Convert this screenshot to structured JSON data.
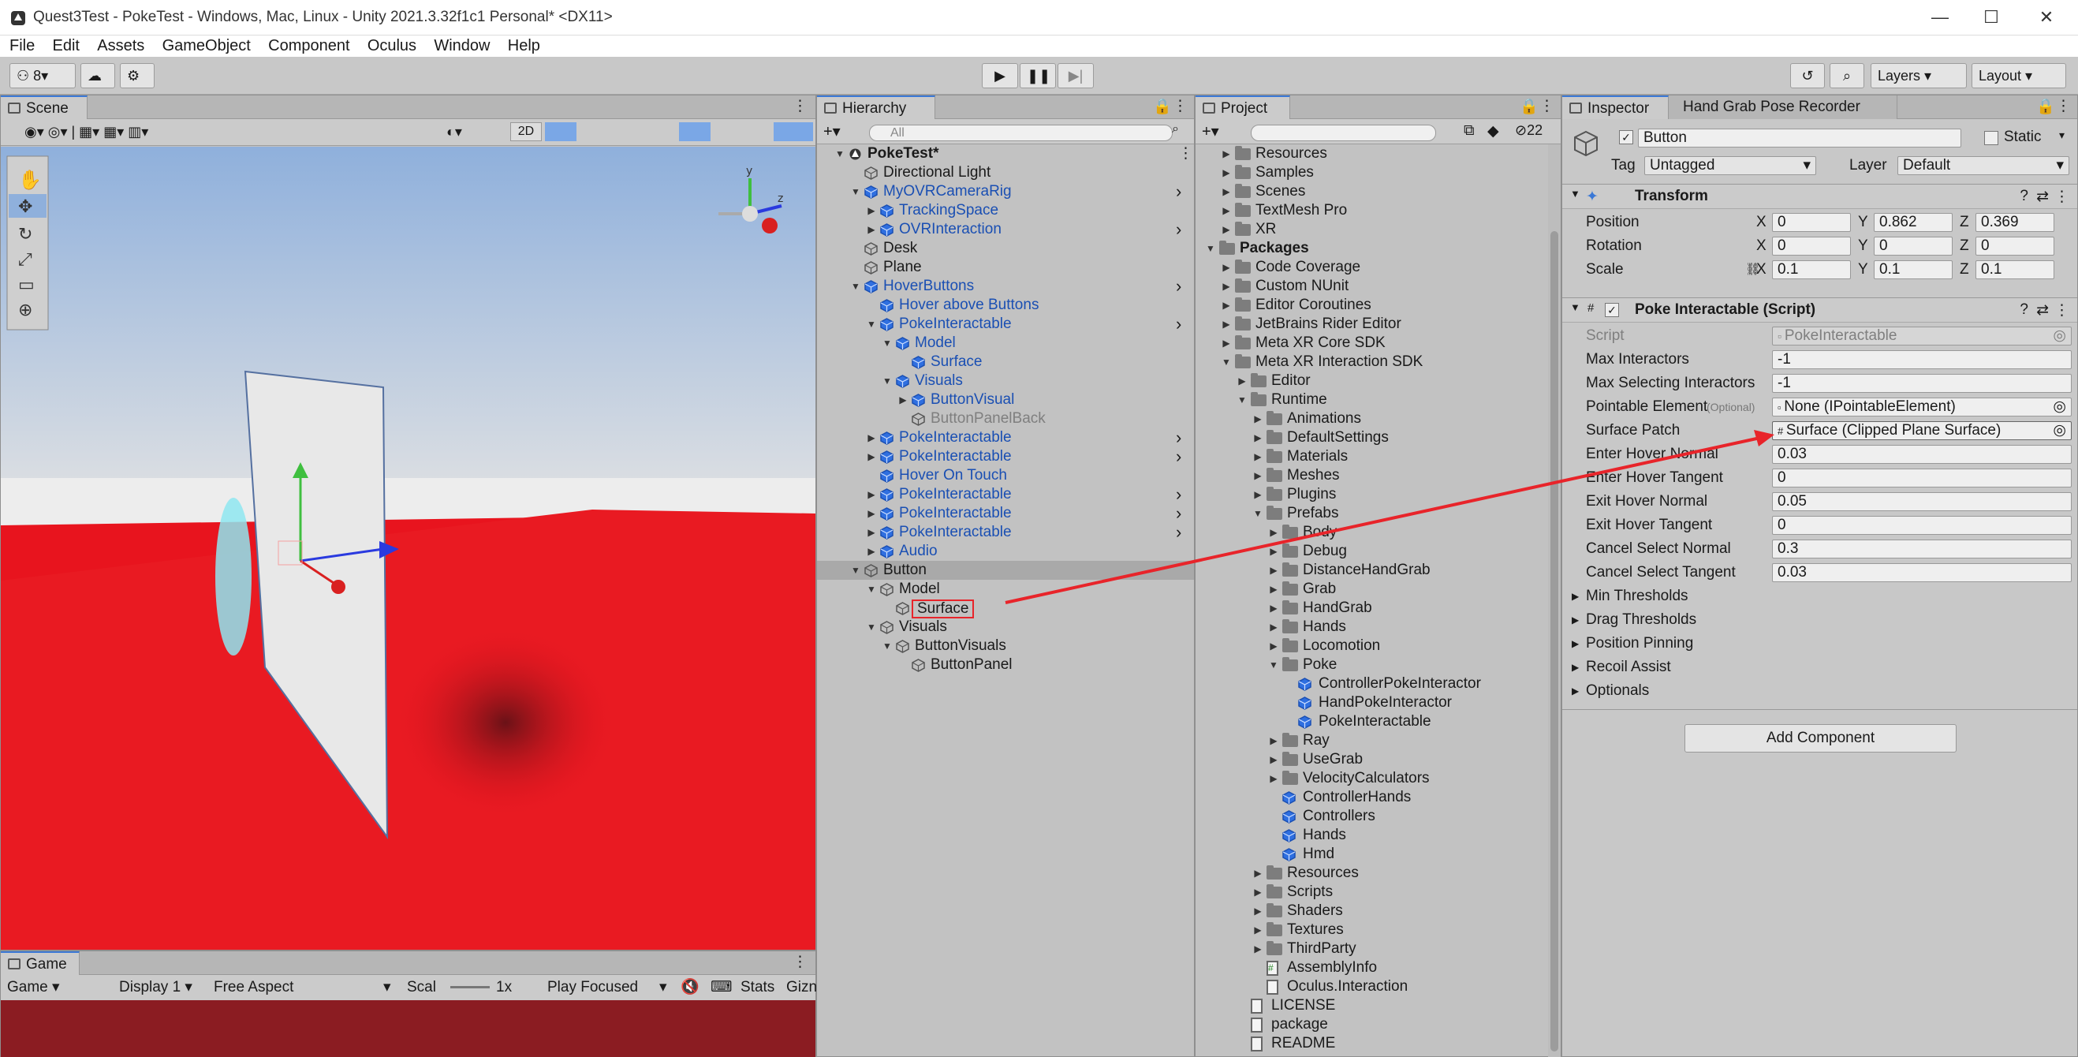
{
  "window": {
    "title": "Quest3Test - PokeTest - Windows, Mac, Linux - Unity 2021.3.32f1c1 Personal* <DX11>",
    "minimize": "—",
    "maximize": "☐",
    "close": "✕"
  },
  "menu": [
    "File",
    "Edit",
    "Assets",
    "GameObject",
    "Component",
    "Oculus",
    "Window",
    "Help"
  ],
  "toolbar": {
    "account_label": "⚇ 8▾",
    "layers_label": "Layers",
    "layout_label": "Layout"
  },
  "scene": {
    "tab": "Scene",
    "mode_2d": "2D"
  },
  "game": {
    "tab": "Game",
    "dropdowns": [
      "Game",
      "Display 1",
      "Free Aspect"
    ],
    "scale_label": "Scal",
    "scale_value": "1x",
    "play_focused": "Play Focused",
    "stats": "Stats",
    "gizmos": "Gizn"
  },
  "hierarchy": {
    "tab": "Hierarchy",
    "search_placeholder": "All",
    "items": [
      {
        "label": "PokeTest*",
        "bold": true,
        "indent": 0,
        "tri": "▼"
      },
      {
        "label": "Directional Light",
        "indent": 1,
        "tri": ""
      },
      {
        "label": "MyOVRCameraRig",
        "indent": 1,
        "tri": "▼",
        "blue": true,
        "arrow": true
      },
      {
        "label": "TrackingSpace",
        "indent": 2,
        "tri": "▶",
        "blue": true
      },
      {
        "label": "OVRInteraction",
        "indent": 2,
        "tri": "▶",
        "blue": true,
        "arrow": true
      },
      {
        "label": "Desk",
        "indent": 1,
        "tri": ""
      },
      {
        "label": "Plane",
        "indent": 1,
        "tri": ""
      },
      {
        "label": "HoverButtons",
        "indent": 1,
        "tri": "▼",
        "blue": true,
        "arrow": true
      },
      {
        "label": "Hover above Buttons",
        "indent": 2,
        "tri": "",
        "blue": true
      },
      {
        "label": "PokeInteractable",
        "indent": 2,
        "tri": "▼",
        "blue": true,
        "arrow": true
      },
      {
        "label": "Model",
        "indent": 3,
        "tri": "▼",
        "blue": true
      },
      {
        "label": "Surface",
        "indent": 4,
        "tri": "",
        "blue": true
      },
      {
        "label": "Visuals",
        "indent": 3,
        "tri": "▼",
        "blue": true
      },
      {
        "label": "ButtonVisual",
        "indent": 4,
        "tri": "▶",
        "blue": true
      },
      {
        "label": "ButtonPanelBack",
        "indent": 4,
        "tri": "",
        "grey": true
      },
      {
        "label": "PokeInteractable",
        "indent": 2,
        "tri": "▶",
        "blue": true,
        "arrow": true
      },
      {
        "label": "PokeInteractable",
        "indent": 2,
        "tri": "▶",
        "blue": true,
        "arrow": true
      },
      {
        "label": "Hover On Touch",
        "indent": 2,
        "tri": "",
        "blue": true
      },
      {
        "label": "PokeInteractable",
        "indent": 2,
        "tri": "▶",
        "blue": true,
        "arrow": true
      },
      {
        "label": "PokeInteractable",
        "indent": 2,
        "tri": "▶",
        "blue": true,
        "arrow": true
      },
      {
        "label": "PokeInteractable",
        "indent": 2,
        "tri": "▶",
        "blue": true,
        "arrow": true
      },
      {
        "label": "Audio",
        "indent": 2,
        "tri": "▶",
        "blue": true
      },
      {
        "label": "Button",
        "indent": 1,
        "tri": "▼",
        "selected": true
      },
      {
        "label": "Model",
        "indent": 2,
        "tri": "▼"
      },
      {
        "label": "Surface",
        "indent": 3,
        "tri": "",
        "boxed": true
      },
      {
        "label": "Visuals",
        "indent": 2,
        "tri": "▼"
      },
      {
        "label": "ButtonVisuals",
        "indent": 3,
        "tri": "▼"
      },
      {
        "label": "ButtonPanel",
        "indent": 4,
        "tri": ""
      }
    ]
  },
  "project": {
    "tab": "Project",
    "badge": "22",
    "items": [
      {
        "label": "Resources",
        "indent": 1,
        "tri": "▶",
        "kind": "folder"
      },
      {
        "label": "Samples",
        "indent": 1,
        "tri": "▶",
        "kind": "folder"
      },
      {
        "label": "Scenes",
        "indent": 1,
        "tri": "▶",
        "kind": "folder"
      },
      {
        "label": "TextMesh Pro",
        "indent": 1,
        "tri": "▶",
        "kind": "folder"
      },
      {
        "label": "XR",
        "indent": 1,
        "tri": "▶",
        "kind": "folder"
      },
      {
        "label": "Packages",
        "indent": 0,
        "tri": "▼",
        "kind": "folder",
        "bold": true
      },
      {
        "label": "Code Coverage",
        "indent": 1,
        "tri": "▶",
        "kind": "folder"
      },
      {
        "label": "Custom NUnit",
        "indent": 1,
        "tri": "▶",
        "kind": "folder"
      },
      {
        "label": "Editor Coroutines",
        "indent": 1,
        "tri": "▶",
        "kind": "folder"
      },
      {
        "label": "JetBrains Rider Editor",
        "indent": 1,
        "tri": "▶",
        "kind": "folder"
      },
      {
        "label": "Meta XR Core SDK",
        "indent": 1,
        "tri": "▶",
        "kind": "folder"
      },
      {
        "label": "Meta XR Interaction SDK",
        "indent": 1,
        "tri": "▼",
        "kind": "folder"
      },
      {
        "label": "Editor",
        "indent": 2,
        "tri": "▶",
        "kind": "folder"
      },
      {
        "label": "Runtime",
        "indent": 2,
        "tri": "▼",
        "kind": "folder"
      },
      {
        "label": "Animations",
        "indent": 3,
        "tri": "▶",
        "kind": "folder"
      },
      {
        "label": "DefaultSettings",
        "indent": 3,
        "tri": "▶",
        "kind": "folder"
      },
      {
        "label": "Materials",
        "indent": 3,
        "tri": "▶",
        "kind": "folder"
      },
      {
        "label": "Meshes",
        "indent": 3,
        "tri": "▶",
        "kind": "folder"
      },
      {
        "label": "Plugins",
        "indent": 3,
        "tri": "▶",
        "kind": "folder"
      },
      {
        "label": "Prefabs",
        "indent": 3,
        "tri": "▼",
        "kind": "folder"
      },
      {
        "label": "Body",
        "indent": 4,
        "tri": "▶",
        "kind": "folder"
      },
      {
        "label": "Debug",
        "indent": 4,
        "tri": "▶",
        "kind": "folder"
      },
      {
        "label": "DistanceHandGrab",
        "indent": 4,
        "tri": "▶",
        "kind": "folder"
      },
      {
        "label": "Grab",
        "indent": 4,
        "tri": "▶",
        "kind": "folder"
      },
      {
        "label": "HandGrab",
        "indent": 4,
        "tri": "▶",
        "kind": "folder"
      },
      {
        "label": "Hands",
        "indent": 4,
        "tri": "▶",
        "kind": "folder"
      },
      {
        "label": "Locomotion",
        "indent": 4,
        "tri": "▶",
        "kind": "folder"
      },
      {
        "label": "Poke",
        "indent": 4,
        "tri": "▼",
        "kind": "folder"
      },
      {
        "label": "ControllerPokeInteractor",
        "indent": 5,
        "tri": "",
        "kind": "prefab"
      },
      {
        "label": "HandPokeInteractor",
        "indent": 5,
        "tri": "",
        "kind": "prefab"
      },
      {
        "label": "PokeInteractable",
        "indent": 5,
        "tri": "",
        "kind": "prefab"
      },
      {
        "label": "Ray",
        "indent": 4,
        "tri": "▶",
        "kind": "folder"
      },
      {
        "label": "UseGrab",
        "indent": 4,
        "tri": "▶",
        "kind": "folder"
      },
      {
        "label": "VelocityCalculators",
        "indent": 4,
        "tri": "▶",
        "kind": "folder"
      },
      {
        "label": "ControllerHands",
        "indent": 4,
        "tri": "",
        "kind": "prefab"
      },
      {
        "label": "Controllers",
        "indent": 4,
        "tri": "",
        "kind": "prefab"
      },
      {
        "label": "Hands",
        "indent": 4,
        "tri": "",
        "kind": "prefab"
      },
      {
        "label": "Hmd",
        "indent": 4,
        "tri": "",
        "kind": "prefab"
      },
      {
        "label": "Resources",
        "indent": 3,
        "tri": "▶",
        "kind": "folder"
      },
      {
        "label": "Scripts",
        "indent": 3,
        "tri": "▶",
        "kind": "folder"
      },
      {
        "label": "Shaders",
        "indent": 3,
        "tri": "▶",
        "kind": "folder"
      },
      {
        "label": "Textures",
        "indent": 3,
        "tri": "▶",
        "kind": "folder"
      },
      {
        "label": "ThirdParty",
        "indent": 3,
        "tri": "▶",
        "kind": "folder"
      },
      {
        "label": "AssemblyInfo",
        "indent": 3,
        "tri": "",
        "kind": "script"
      },
      {
        "label": "Oculus.Interaction",
        "indent": 3,
        "tri": "",
        "kind": "asm"
      },
      {
        "label": "LICENSE",
        "indent": 2,
        "tri": "",
        "kind": "file"
      },
      {
        "label": "package",
        "indent": 2,
        "tri": "",
        "kind": "file"
      },
      {
        "label": "README",
        "indent": 2,
        "tri": "",
        "kind": "file"
      }
    ]
  },
  "inspector": {
    "tab": "Inspector",
    "tab2": "Hand Grab Pose Recorder",
    "object_name": "Button",
    "static_label": "Static",
    "tag_label": "Tag",
    "tag_value": "Untagged",
    "layer_label": "Layer",
    "layer_value": "Default",
    "transform": {
      "title": "Transform",
      "rows": [
        {
          "label": "Position",
          "x": "0",
          "y": "0.862",
          "z": "0.369"
        },
        {
          "label": "Rotation",
          "x": "0",
          "y": "0",
          "z": "0"
        },
        {
          "label": "Scale",
          "x": "0.1",
          "y": "0.1",
          "z": "0.1"
        }
      ]
    },
    "poke": {
      "title": "Poke Interactable (Script)",
      "script_label": "Script",
      "script_value": "PokeInteractable",
      "fields": [
        {
          "label": "Max Interactors",
          "value": "-1"
        },
        {
          "label": "Max Selecting Interactors",
          "value": "-1"
        },
        {
          "label": "Pointable Element",
          "optional": "(Optional)",
          "value": "None (IPointableElement)"
        },
        {
          "label": "Surface Patch",
          "value": "Surface (Clipped Plane Surface)"
        },
        {
          "label": "Enter Hover Normal",
          "value": "0.03"
        },
        {
          "label": "Enter Hover Tangent",
          "value": "0"
        },
        {
          "label": "Exit Hover Normal",
          "value": "0.05"
        },
        {
          "label": "Exit Hover Tangent",
          "value": "0"
        },
        {
          "label": "Cancel Select Normal",
          "value": "0.3"
        },
        {
          "label": "Cancel Select Tangent",
          "value": "0.03"
        }
      ],
      "foldouts": [
        "Min Thresholds",
        "Drag Thresholds",
        "Position Pinning",
        "Recoil Assist",
        "Optionals"
      ]
    },
    "add_component": "Add Component"
  },
  "colors": {
    "accent": "#3a78d6",
    "annotation_red": "#e8242a",
    "floor_red": "#e8141e",
    "sky": "#a9c4e6"
  }
}
